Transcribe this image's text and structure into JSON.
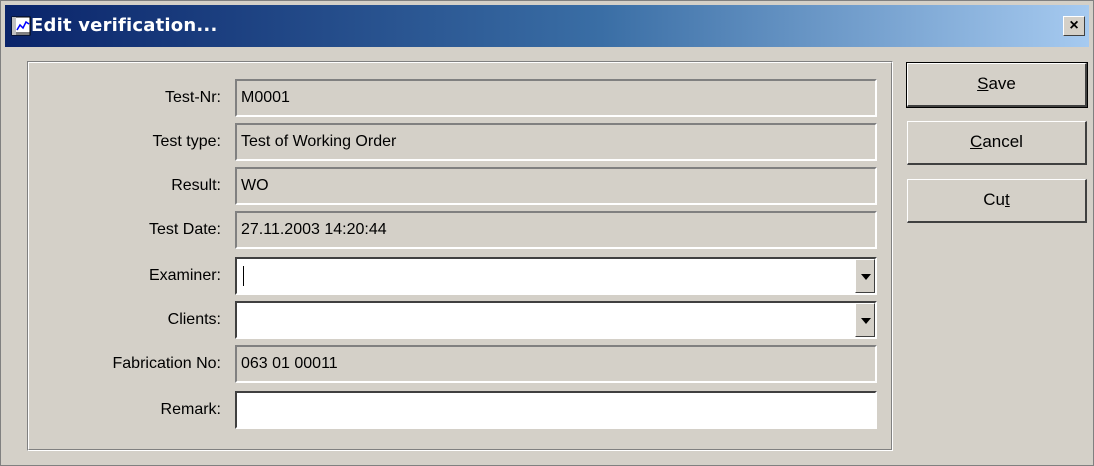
{
  "window": {
    "title": "Edit verification..."
  },
  "buttons": {
    "close_label": "×",
    "save_mnemonic": "S",
    "save_rest": "ave",
    "cancel_mnemonic": "C",
    "cancel_rest": "ancel",
    "cut_prefix": "Cu",
    "cut_mnemonic": "t"
  },
  "form": {
    "test_nr": {
      "label": "Test-Nr:",
      "value": "M0001"
    },
    "test_type": {
      "label": "Test type:",
      "value": "Test of Working Order"
    },
    "result": {
      "label": "Result:",
      "value": "WO"
    },
    "test_date": {
      "label": "Test Date:",
      "value": "27.11.2003 14:20:44"
    },
    "examiner": {
      "label": "Examiner:",
      "value": ""
    },
    "clients": {
      "label": "Clients:",
      "value": ""
    },
    "fabrication_no": {
      "label": "Fabrication No:",
      "value": "063 01 00011"
    },
    "remark": {
      "label": "Remark:",
      "value": ""
    }
  }
}
